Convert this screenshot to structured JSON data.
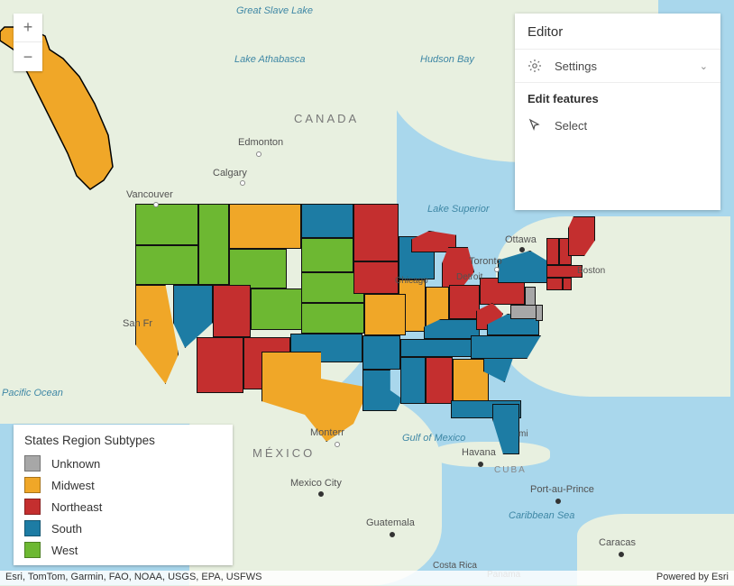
{
  "zoom": {
    "in": "+",
    "out": "−"
  },
  "editor": {
    "title": "Editor",
    "settings_label": "Settings",
    "section_label": "Edit features",
    "select_label": "Select"
  },
  "legend": {
    "title": "States Region Subtypes",
    "items": [
      {
        "label": "Unknown",
        "color": "#a7a7a7"
      },
      {
        "label": "Midwest",
        "color": "#f0a728"
      },
      {
        "label": "Northeast",
        "color": "#c42f2f"
      },
      {
        "label": "South",
        "color": "#1d7ca4"
      },
      {
        "label": "West",
        "color": "#6db832"
      }
    ]
  },
  "map_labels": {
    "great_slave": "Great Slave Lake",
    "athabasca": "Lake Athabasca",
    "hudson_bay": "Hudson Bay",
    "canada": "CANADA",
    "mexico": "MÉXICO",
    "cuba": "CUBA",
    "superior": "Lake Superior",
    "gulf_mexico": "Gulf of Mexico",
    "caribbean": "Caribbean Sea",
    "pacific": "Pacific Ocean",
    "edmonton": "Edmonton",
    "calgary": "Calgary",
    "vancouver": "Vancouver",
    "ottawa": "Ottawa",
    "toronto": "Toronto",
    "detroit": "Detroit",
    "chicago": "Chicago",
    "boston": "Boston",
    "san_fr": "San Fr",
    "monterr": "Monterr",
    "mexico_city": "Mexico City",
    "guatemala": "Guatemala",
    "havana": "Havana",
    "port_au_prince": "Port-au-Prince",
    "caracas": "Caracas",
    "costa_rica": "Costa Rica",
    "panama": "Panama",
    "miami": "mi"
  },
  "attribution": {
    "left": "Esri, TomTom, Garmin, FAO, NOAA, USGS, EPA, USFWS",
    "right": "Powered by Esri"
  },
  "states": {
    "WA": "West",
    "OR": "West",
    "ID": "West",
    "MT": "Midwest",
    "WY": "West",
    "NV": "South",
    "UT": "Northeast",
    "CO": "West",
    "AZ": "Northeast",
    "NM": "Northeast",
    "CA": "Midwest",
    "ND": "South",
    "SD": "West",
    "NE": "West",
    "KS": "West",
    "OK": "South",
    "TX": "Midwest",
    "MN": "Northeast",
    "IA": "Northeast",
    "MO": "Midwest",
    "AR": "South",
    "LA": "South",
    "WI": "South",
    "IL": "Midwest",
    "MI": "Northeast",
    "IN": "Midwest",
    "OH": "Northeast",
    "KY": "South",
    "TN": "South",
    "MS": "South",
    "AL": "Northeast",
    "GA": "Midwest",
    "FL": "South",
    "SC": "South",
    "NC": "South",
    "VA": "South",
    "WV": "Northeast",
    "MD": "Unknown",
    "DE": "Unknown",
    "PA": "Northeast",
    "NJ": "Unknown",
    "NY": "South",
    "CT": "Northeast",
    "RI": "Northeast",
    "MA": "Northeast",
    "VT": "Northeast",
    "NH": "Northeast",
    "ME": "Northeast"
  }
}
